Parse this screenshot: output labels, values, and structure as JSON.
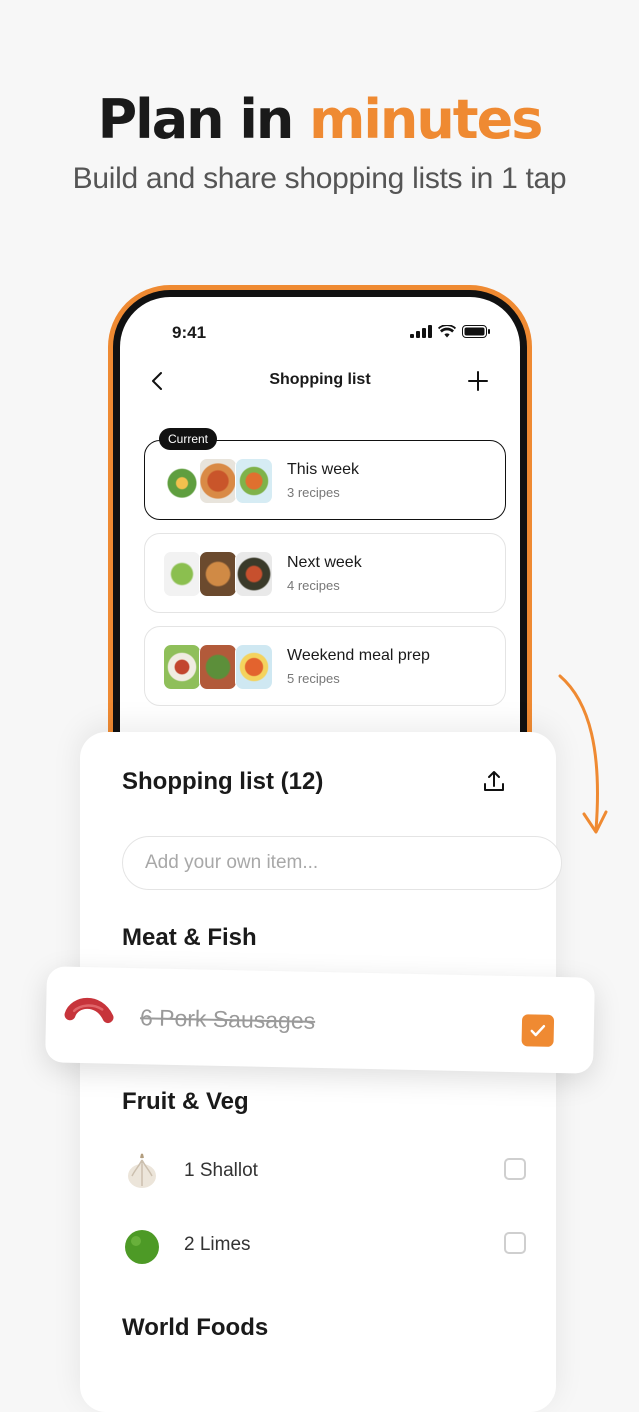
{
  "hero": {
    "title_part1": "Plan in ",
    "title_accent": "minutes",
    "subtitle": "Build and share shopping lists in 1 tap"
  },
  "status_bar": {
    "time": "9:41"
  },
  "nav": {
    "title": "Shopping list"
  },
  "lists": [
    {
      "title": "This week",
      "subtitle": "3 recipes",
      "badge": "Current"
    },
    {
      "title": "Next week",
      "subtitle": "4 recipes"
    },
    {
      "title": "Weekend meal prep",
      "subtitle": "5 recipes"
    }
  ],
  "sheet": {
    "title": "Shopping list (12)",
    "input_placeholder": "Add your own item...",
    "sections": [
      {
        "name": "Meat & Fish"
      },
      {
        "name": "Fruit & Veg"
      },
      {
        "name": "World Foods"
      }
    ],
    "checked_item": {
      "label": "6 Pork Sausages",
      "checked": true
    },
    "items": [
      {
        "label": "1 Shallot",
        "checked": false
      },
      {
        "label": "2 Limes",
        "checked": false
      }
    ]
  },
  "colors": {
    "accent": "#ef8a32",
    "text": "#1a1a1a",
    "muted": "#777777"
  }
}
